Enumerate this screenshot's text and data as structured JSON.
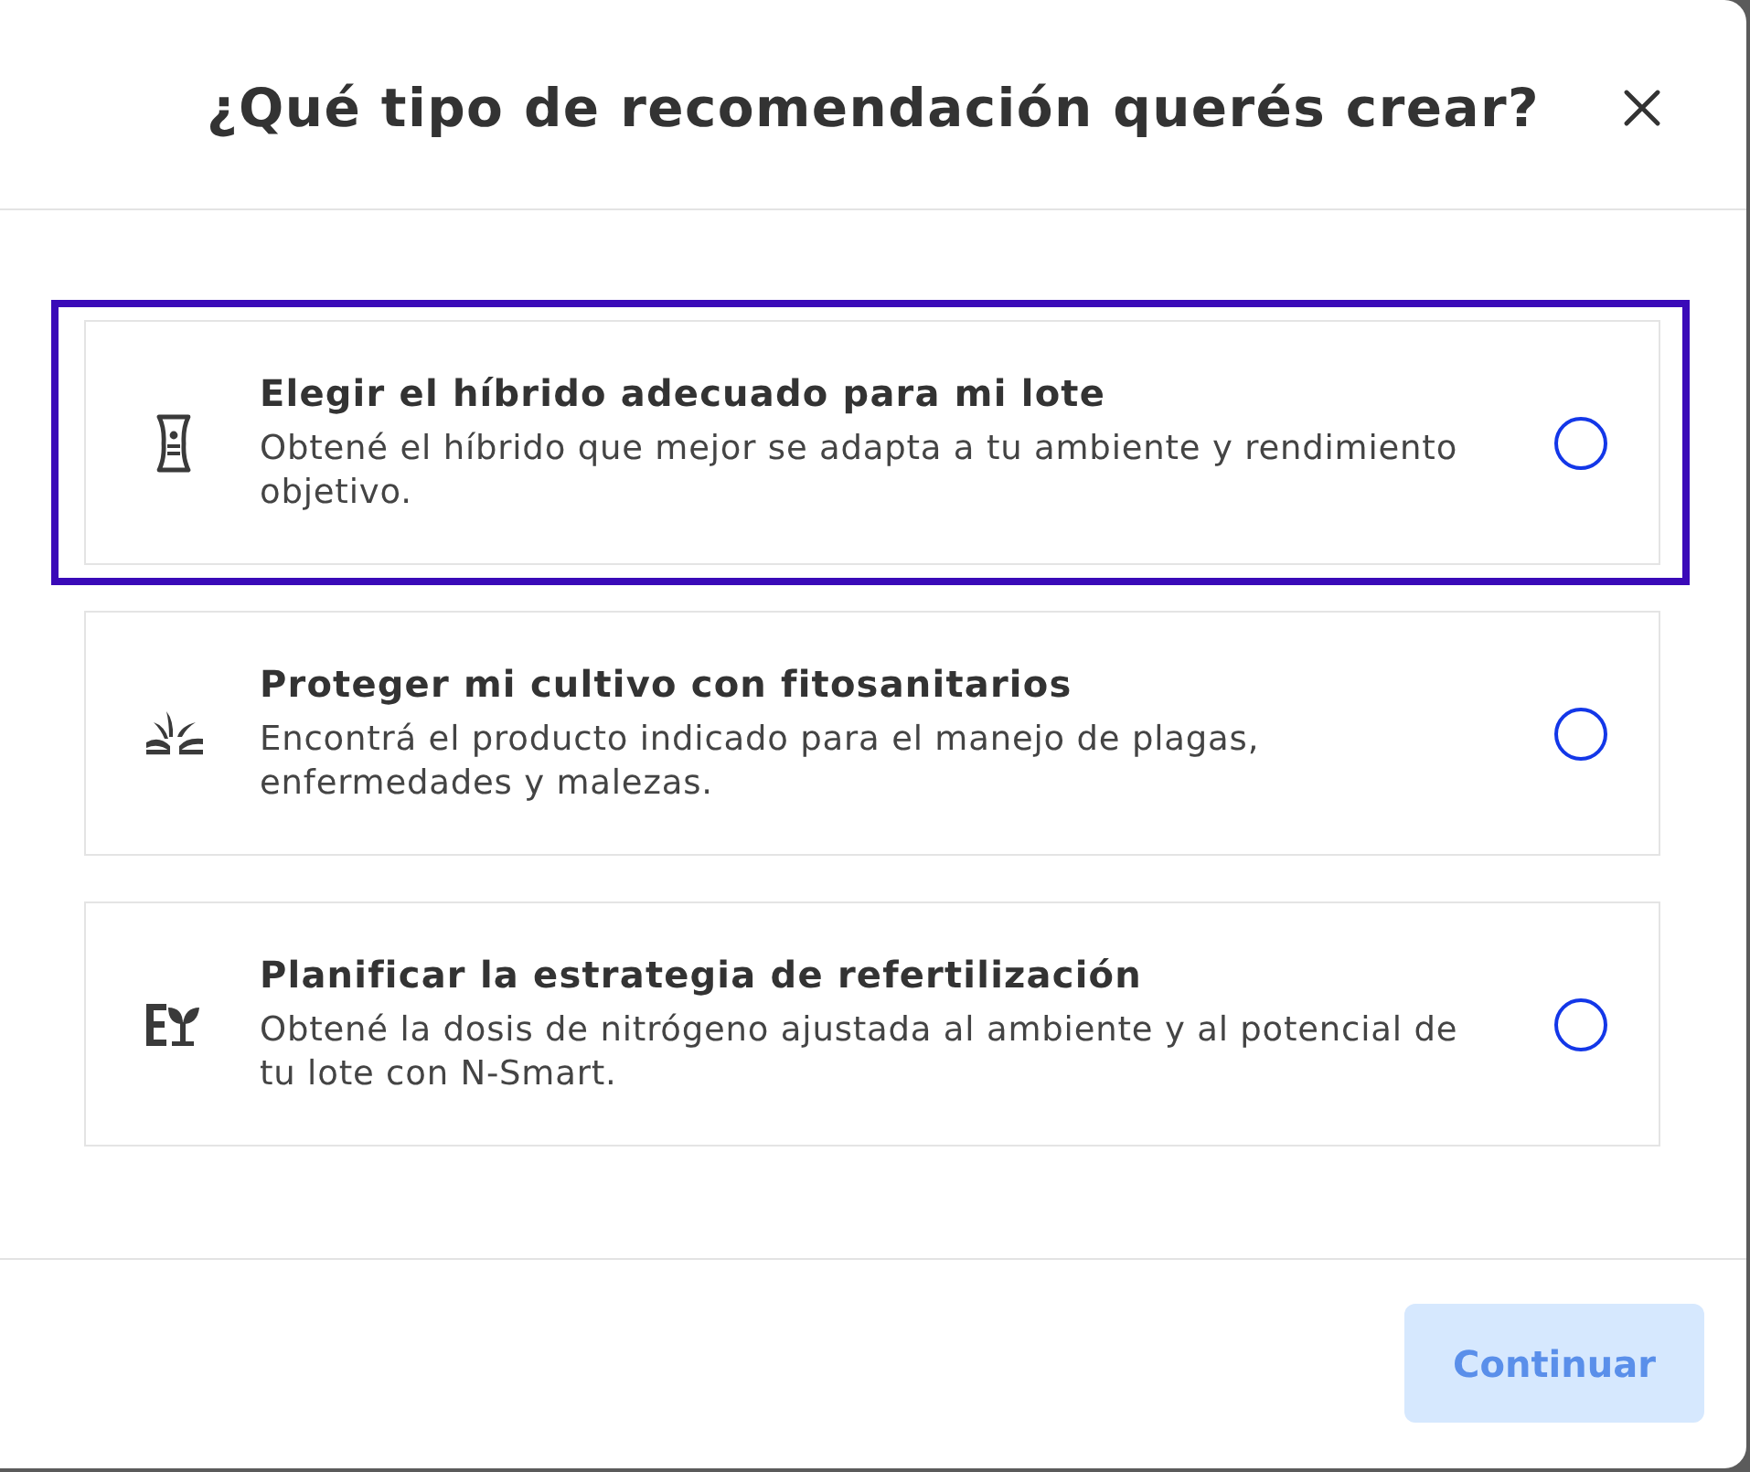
{
  "dialog": {
    "title": "¿Qué tipo de recomendación querés crear?"
  },
  "options": [
    {
      "title": "Elegir el híbrido adecuado para mi lote",
      "description": "Obtené el híbrido que mejor se adapta a tu ambiente y rendimiento objetivo.",
      "selected": false,
      "focused": true
    },
    {
      "title": "Proteger mi cultivo con fitosanitarios",
      "description": "Encontrá el producto indicado para el manejo de plagas, enfermedades y malezas.",
      "selected": false,
      "focused": false
    },
    {
      "title": "Planificar la estrategia de refertilización",
      "description": "Obtené la dosis de nitrógeno ajustada al ambiente y al potencial de tu lote con N-Smart.",
      "selected": false,
      "focused": false
    }
  ],
  "footer": {
    "button": {
      "label": "Continuar",
      "disabled": true
    }
  }
}
